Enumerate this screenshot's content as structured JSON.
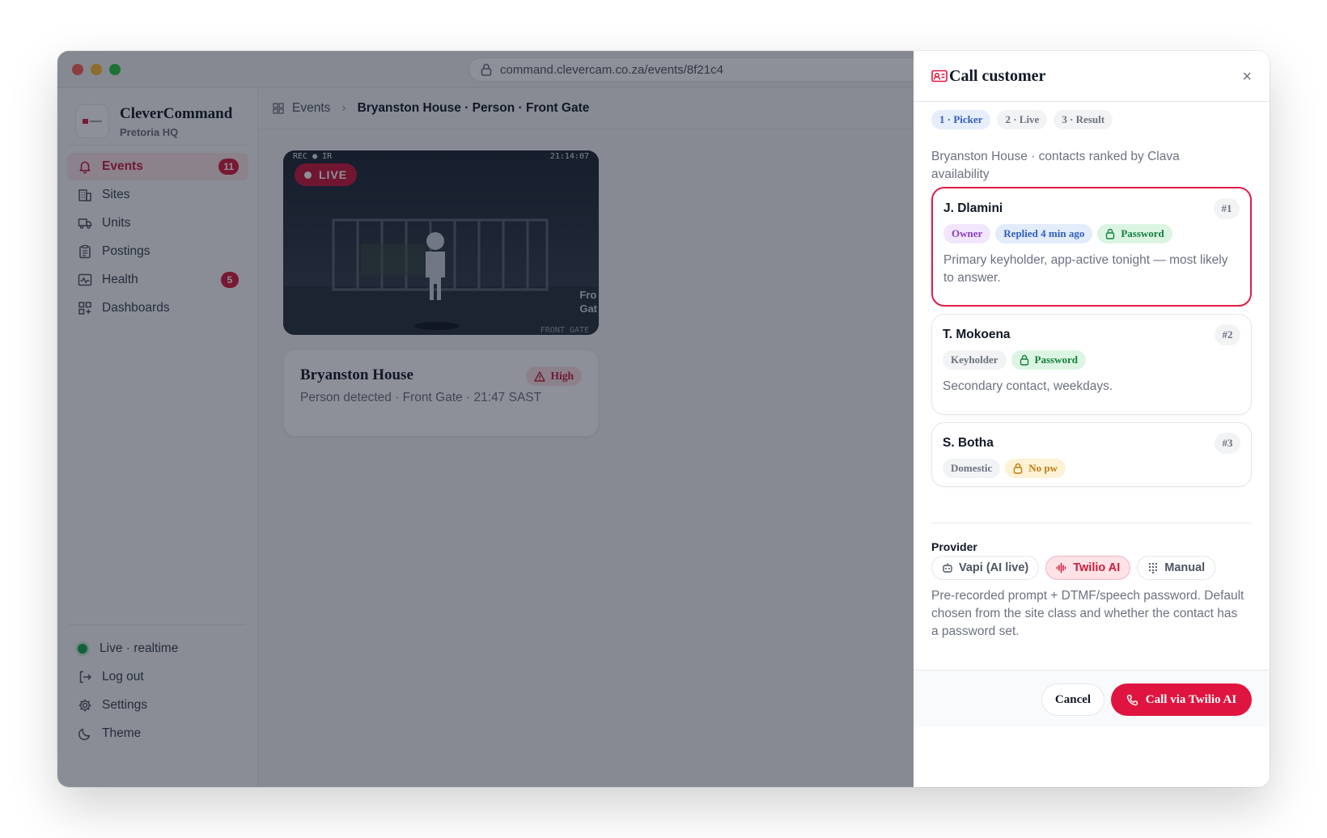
{
  "browser": {
    "url": "command.clevercam.co.za/events/8f21c4"
  },
  "brand": {
    "name": "CleverCommand",
    "subtitle": "Pretoria HQ"
  },
  "sidebar": {
    "items": [
      {
        "label": "Events",
        "icon": "bell-icon",
        "badge": "11",
        "active": true
      },
      {
        "label": "Sites",
        "icon": "building-icon"
      },
      {
        "label": "Units",
        "icon": "truck-icon"
      },
      {
        "label": "Postings",
        "icon": "clipboard-icon"
      },
      {
        "label": "Health",
        "icon": "activity-icon",
        "badge": "5"
      },
      {
        "label": "Dashboards",
        "icon": "grid-icon"
      }
    ],
    "bottom": {
      "status": "Live · realtime",
      "logout": "Log out",
      "settings": "Settings",
      "theme": "Theme"
    }
  },
  "breadcrumb": {
    "section": "Events",
    "current": "Bryanston House · Person · Front Gate"
  },
  "camera": {
    "overlay_top": "REC ● IR",
    "timestamp": "21:14:07",
    "live_label": "LIVE",
    "side_label_1": "Fro",
    "side_label_2": "Gat",
    "footer": "FRONT GATE"
  },
  "event": {
    "site": "Bryanston House",
    "details": "Person detected · Front Gate · 21:47 SAST",
    "severity": "High"
  },
  "call_panel": {
    "title": "Call customer",
    "close": "×",
    "steps": [
      "1 · Picker",
      "2 · Live",
      "3 · Result"
    ],
    "intro": "Bryanston House · contacts ranked by Clava availability",
    "contacts": [
      {
        "name": "J. Dlamini",
        "rank": "#1",
        "tags": [
          "Owner",
          "Replied 4 min ago",
          "Password"
        ],
        "description": "Primary keyholder, app-active tonight — most likely to answer."
      },
      {
        "name": "T. Mokoena",
        "rank": "#2",
        "tags": [
          "Keyholder",
          "Password"
        ],
        "description": "Secondary contact, weekdays."
      },
      {
        "name": "S. Botha",
        "rank": "#3",
        "tags": [
          "Domestic",
          "No pw"
        ]
      }
    ],
    "provider": {
      "label": "Provider",
      "options": [
        "Vapi (AI live)",
        "Twilio AI",
        "Manual"
      ],
      "selected": "Twilio AI",
      "description": "Pre-recorded prompt + DTMF/speech password. Default chosen from the site class and whether the contact has a password set."
    },
    "buttons": {
      "cancel": "Cancel",
      "call": "Call via Twilio AI"
    }
  },
  "colors": {
    "accent": "#e0153f",
    "live": "#16a34a"
  }
}
